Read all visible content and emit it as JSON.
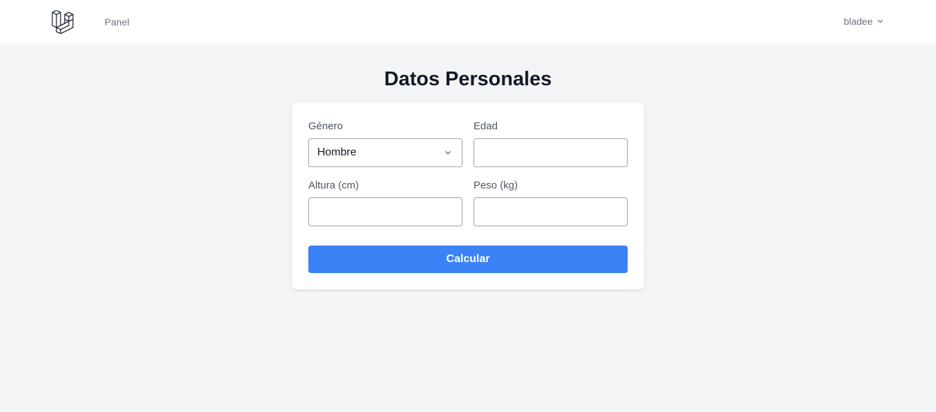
{
  "nav": {
    "logo_icon": "laravel-logo-icon",
    "links": [
      {
        "label": "Panel"
      }
    ],
    "user": {
      "name": "bladee",
      "icon": "chevron-down-icon"
    }
  },
  "page": {
    "title": "Datos Personales"
  },
  "form": {
    "genero": {
      "label": "Género",
      "value": "Hombre",
      "icon": "chevron-down-icon"
    },
    "edad": {
      "label": "Edad",
      "value": ""
    },
    "altura": {
      "label": "Altura (cm)",
      "value": ""
    },
    "peso": {
      "label": "Peso (kg)",
      "value": ""
    },
    "submit_label": "Calcular"
  },
  "colors": {
    "accent": "#3b82f6",
    "background": "#f3f4f6",
    "card": "#ffffff"
  }
}
